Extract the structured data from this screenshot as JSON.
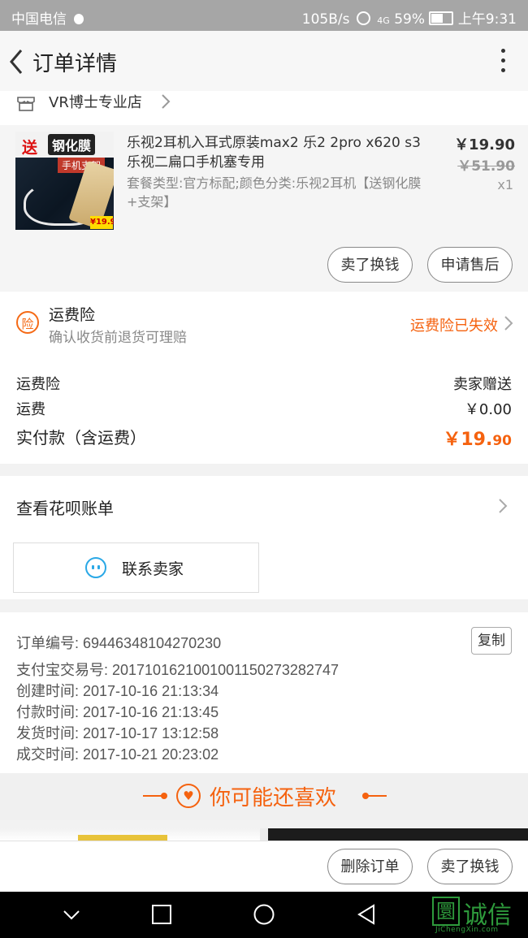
{
  "status_bar": {
    "carrier": "中国电信",
    "speed": "105B/s",
    "battery": "59%",
    "time": "上午9:31"
  },
  "header": {
    "title": "订单详情"
  },
  "shop": {
    "name": "VR博士专业店"
  },
  "product": {
    "title": "乐视2耳机入耳式原装max2 乐2 2pro x620 s3乐视二扁口手机塞专用",
    "spec": "套餐类型:官方标配;颜色分类:乐视2耳机【送钢化膜+支架】",
    "price": "￥19.90",
    "original_price": "￥51.90",
    "quantity": "x1",
    "thumb_banner_red": "送",
    "thumb_banner_black": "钢化膜",
    "thumb_sub": "手机支架",
    "thumb_price": "¥19.9",
    "btn_sell": "卖了换钱",
    "btn_aftersale": "申请售后"
  },
  "insurance": {
    "badge": "险",
    "title": "运费险",
    "subtitle": "确认收货前退货可理赔",
    "status": "运费险已失效"
  },
  "cost": {
    "insurance_label": "运费险",
    "insurance_value": "卖家赠送",
    "shipping_label": "运费",
    "shipping_value": "￥0.00",
    "total_label": "实付款（含运费）",
    "total_value_main": "￥19.",
    "total_value_cents": "90"
  },
  "huabei": {
    "label": "查看花呗账单"
  },
  "contact": {
    "label": "联系卖家"
  },
  "order_info": {
    "order_no": "订单编号: 69446348104270230",
    "alipay_no": "支付宝交易号: 2017101621001001150273282747",
    "created": "创建时间: 2017-10-16 21:13:34",
    "paid": "付款时间: 2017-10-16 21:13:45",
    "shipped": "发货时间: 2017-10-17 13:12:58",
    "completed": "成交时间: 2017-10-21 20:23:02",
    "copy_label": "复制"
  },
  "recommend": {
    "title": "你可能还喜欢"
  },
  "bottom_bar": {
    "delete_label": "删除订单",
    "sell_label": "卖了换钱"
  },
  "watermark": {
    "char_box": "圜",
    "chars": "诚信",
    "url": "JiChengXin.com"
  },
  "colors": {
    "accent": "#f5620f",
    "contact_icon": "#2aa8e6",
    "watermark": "#2e9b3c"
  }
}
